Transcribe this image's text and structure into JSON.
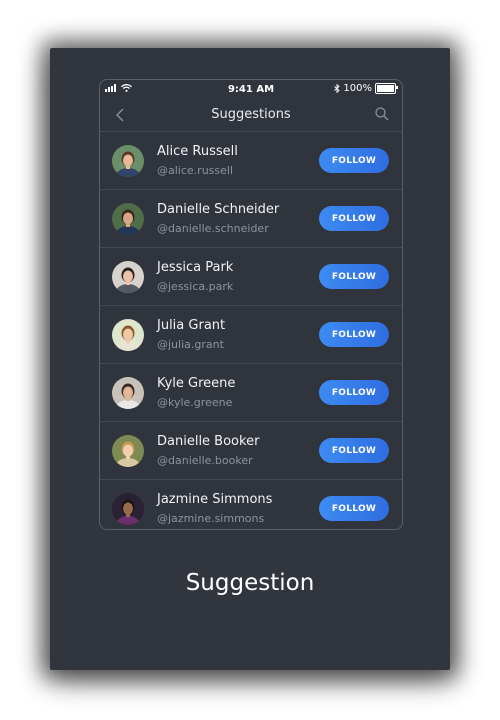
{
  "status_bar": {
    "time": "9:41 AM",
    "battery": "100%"
  },
  "nav": {
    "title": "Suggestions"
  },
  "users": [
    {
      "name": "Alice Russell",
      "handle": "@alice.russell",
      "follow_label": "FOLLOW",
      "avatar_bg": "#6b8f6a",
      "skin": "#e5b99a",
      "hair": "#5a3a22",
      "shirt": "#2f4566"
    },
    {
      "name": "Danielle Schneider",
      "handle": "@danielle.schneider",
      "follow_label": "FOLLOW",
      "avatar_bg": "#4f6e47",
      "skin": "#d9a586",
      "hair": "#3a2718",
      "shirt": "#233653"
    },
    {
      "name": "Jessica Park",
      "handle": "@jessica.park",
      "follow_label": "FOLLOW",
      "avatar_bg": "#d7d2cc",
      "skin": "#e9c2a7",
      "hair": "#2b221d",
      "shirt": "#555a62"
    },
    {
      "name": "Julia Grant",
      "handle": "@julia.grant",
      "follow_label": "FOLLOW",
      "avatar_bg": "#dfe6cf",
      "skin": "#f0c8a6",
      "hair": "#8a5a2b",
      "shirt": "#e9e3d6"
    },
    {
      "name": "Kyle Greene",
      "handle": "@kyle.greene",
      "follow_label": "FOLLOW",
      "avatar_bg": "#c9c2ba",
      "skin": "#e0b59a",
      "hair": "#3b2a20",
      "shirt": "#e8e8e8"
    },
    {
      "name": "Danielle Booker",
      "handle": "@danielle.booker",
      "follow_label": "FOLLOW",
      "avatar_bg": "#7d8a52",
      "skin": "#f1cfae",
      "hair": "#c99a55",
      "shirt": "#d8c7a2"
    },
    {
      "name": "Jazmine Simmons",
      "handle": "@jazmine.simmons",
      "follow_label": "FOLLOW",
      "avatar_bg": "#2a2233",
      "skin": "#9a6a4f",
      "hair": "#1a1214",
      "shirt": "#6b2f6f"
    }
  ],
  "caption": "Suggestion",
  "colors": {
    "card_bg": "#30353e",
    "accent": "#3d8bf2"
  }
}
